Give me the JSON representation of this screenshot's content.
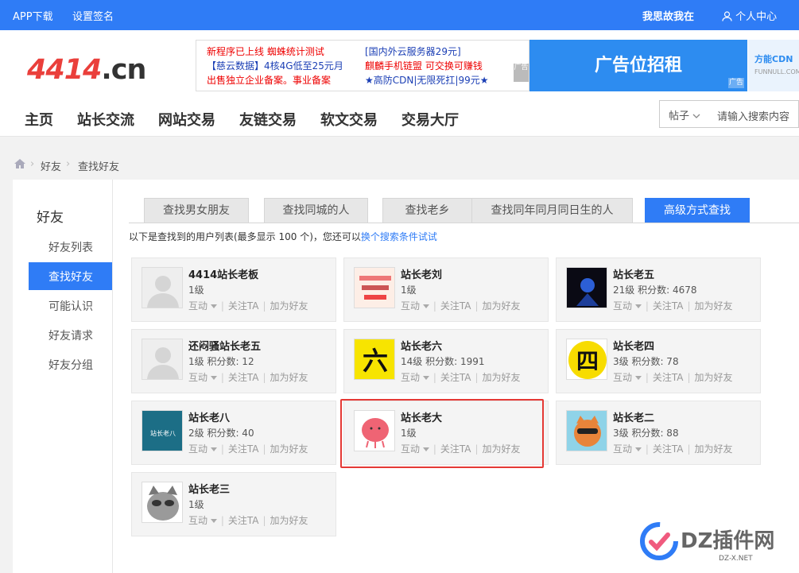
{
  "topbar": {
    "app_download": "APP下载",
    "set_signature": "设置签名",
    "username": "我思故我在",
    "user_center": "个人中心"
  },
  "logo": {
    "text_red": "4414",
    "text_dark": ".cn"
  },
  "ad": {
    "lines_left": [
      "新程序已上线 蜘蛛统计测试",
      "【慈云数据】4核4G低至25元月",
      "出售独立企业备案。事业备案"
    ],
    "lines_right": [
      "[国内外云服务器29元]",
      "麒麟手机链盟 可交换可赚钱",
      "★高防CDN|无限死扛|99元★"
    ],
    "tag": "广告",
    "banner": "广告位招租",
    "banner_tag": "广告",
    "funnull": "方能CDN",
    "funnull_sub": "FUNNULL.COM"
  },
  "nav": {
    "items": [
      "主页",
      "站长交流",
      "网站交易",
      "友链交易",
      "软文交易",
      "交易大厅"
    ]
  },
  "search": {
    "select_value": "帖子",
    "placeholder": "请输入搜索内容"
  },
  "breadcrumb": {
    "items": [
      "好友",
      "查找好友"
    ]
  },
  "sidebar": {
    "title": "好友",
    "items": [
      "好友列表",
      "查找好友",
      "可能认识",
      "好友请求",
      "好友分组"
    ],
    "active_index": 1
  },
  "tabs": {
    "items": [
      "查找男女朋友",
      "查找同城的人",
      "查找老乡",
      "查找同年同月同日生的人",
      "高级方式查找"
    ],
    "active_index": 4
  },
  "notice": {
    "text": "以下是查找到的用户列表(最多显示 100 个)，您还可以",
    "link": "换个搜索条件试试"
  },
  "actions": {
    "interact": "互动",
    "follow": "关注TA",
    "add_friend": "加为好友"
  },
  "users": [
    {
      "name": "4414站长老板",
      "info": "1级",
      "avatar": "default"
    },
    {
      "name": "站长老刘",
      "info": "1级",
      "avatar": "text"
    },
    {
      "name": "站长老五",
      "info": "21级  积分数: 4678",
      "avatar": "dark"
    },
    {
      "name": "还闷骚站长老五",
      "info": "1级  积分数: 12",
      "avatar": "default"
    },
    {
      "name": "站长老六",
      "info": "14级  积分数: 1991",
      "avatar": "six"
    },
    {
      "name": "站长老四",
      "info": "3级  积分数: 78",
      "avatar": "four"
    },
    {
      "name": "站长老八",
      "info": "2级  积分数: 40",
      "avatar": "eight"
    },
    {
      "name": "站长老大",
      "info": "1级",
      "avatar": "pink"
    },
    {
      "name": "站长老二",
      "info": "3级  积分数: 88",
      "avatar": "dog"
    },
    {
      "name": "站长老三",
      "info": "1级",
      "avatar": "raccoon"
    }
  ],
  "avatar_text": {
    "six": "六",
    "four": "四",
    "eight": "站长老八"
  },
  "watermark": {
    "text": "DZ插件网",
    "sub": "DZ-X.NET"
  },
  "colors": {
    "primary": "#2f7cf6",
    "highlight": "#e53935"
  }
}
